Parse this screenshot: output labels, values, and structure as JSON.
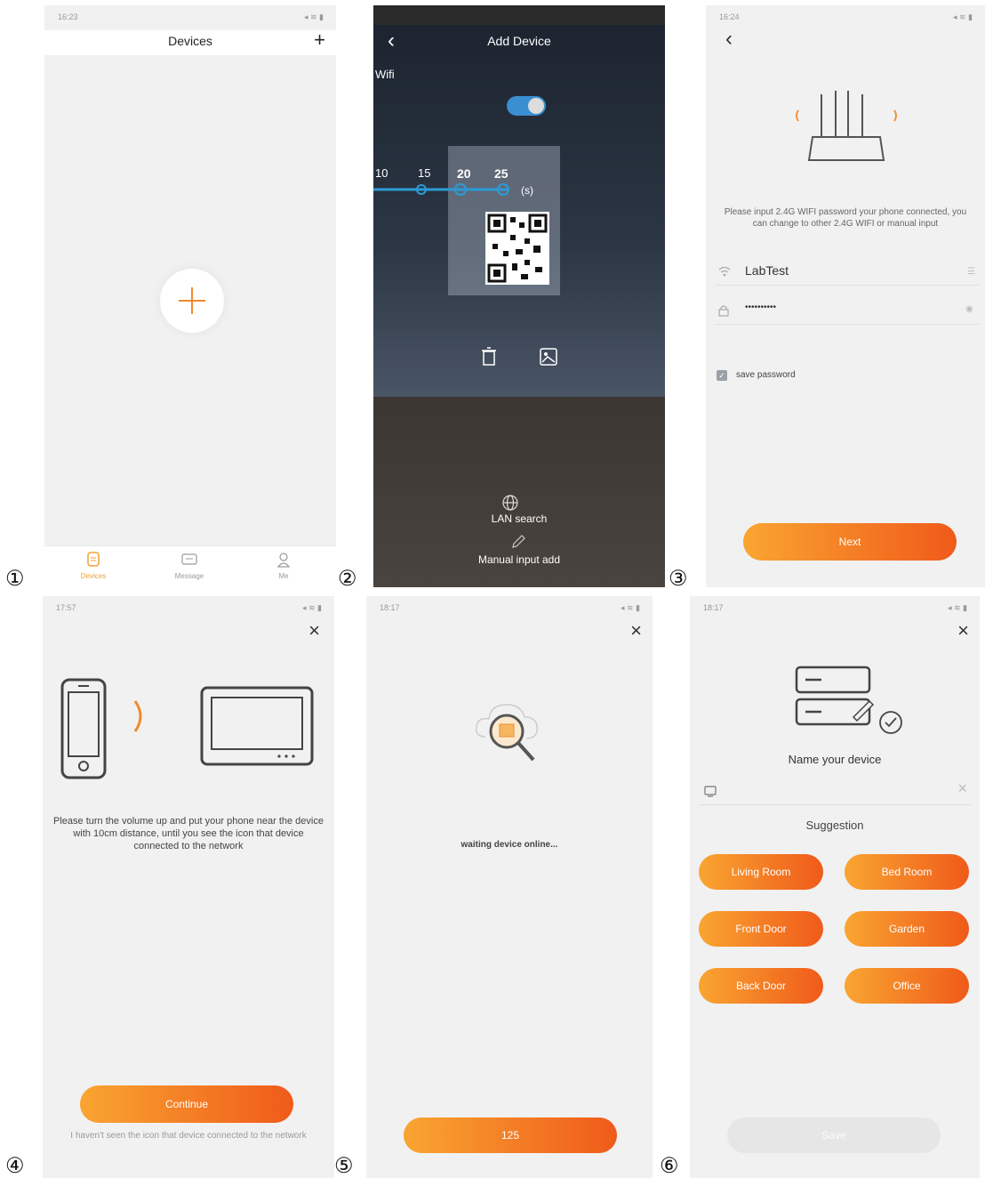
{
  "step_numbers": [
    "①",
    "②",
    "③",
    "④",
    "⑤",
    "⑥"
  ],
  "s1": {
    "status_time": "16:23",
    "title": "Devices",
    "plus_glyph": "+",
    "tabs": [
      {
        "label": "Devices",
        "active": true
      },
      {
        "label": "Message",
        "active": false
      },
      {
        "label": "Me",
        "active": false
      }
    ]
  },
  "s2": {
    "title": "Add Device",
    "back_glyph": "‹",
    "wifi_text": "Wifi",
    "scale_labels": [
      "10",
      "15",
      "20",
      "25"
    ],
    "unit": "(s)",
    "lan_search": "LAN search",
    "manual_input": "Manual input add"
  },
  "s3": {
    "status_time": "16:24",
    "back_glyph": "‹",
    "description": "Please input 2.4G WIFI password your phone connected, you can change to other 2.4G WIFI or manual input",
    "wifi_name": "LabTest",
    "password_mask": "••••••••••",
    "save_password": "save password",
    "next": "Next"
  },
  "s4": {
    "status_time": "17:57",
    "close_glyph": "×",
    "description": "Please turn the volume up and put your phone near the device with 10cm distance, until you see the icon that device connected to the network",
    "continue": "Continue",
    "not_seen": "I haven't seen the icon that device connected to the network"
  },
  "s5": {
    "status_time": "18:17",
    "close_glyph": "×",
    "waiting": "waiting device online...",
    "countdown": "125"
  },
  "s6": {
    "status_time": "18:17",
    "close_glyph": "×",
    "name_title": "Name your device",
    "suggestion": "Suggestion",
    "suggestions": [
      "Living Room",
      "Bed Room",
      "Front Door",
      "Garden",
      "Back Door",
      "Office"
    ],
    "save": "Save"
  },
  "colors": {
    "accent_start": "#f9a531",
    "accent_end": "#f05a1a",
    "screen_bg": "#f1f1f1",
    "scan_bg": "#2a2c30"
  }
}
